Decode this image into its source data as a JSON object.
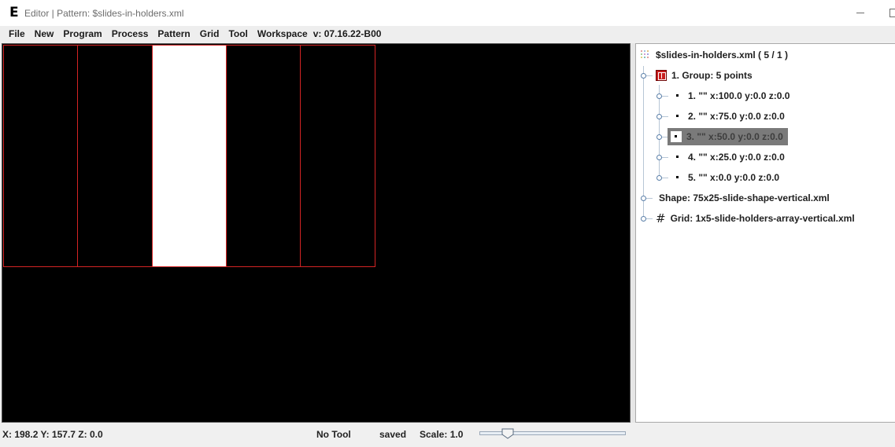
{
  "window": {
    "app_letter": "E",
    "title": "Editor | Pattern: $slides-in-holders.xml"
  },
  "menu": {
    "items": [
      "File",
      "New",
      "Program",
      "Process",
      "Pattern",
      "Grid",
      "Tool",
      "Workspace"
    ],
    "version": "v: 07.16.22-B00"
  },
  "canvas": {
    "slot_fill": [
      "black",
      "black",
      "white",
      "black",
      "black"
    ],
    "colors": {
      "background": "#000000",
      "slot_border": "#d42424",
      "highlight": "#ffffff"
    }
  },
  "tree": {
    "root": "$slides-in-holders.xml ( 5 / 1 )",
    "group": "1. Group: 5 points",
    "points": [
      "1. \"\" x:100.0 y:0.0 z:0.0",
      "2. \"\" x:75.0 y:0.0 z:0.0",
      "3. \"\" x:50.0 y:0.0 z:0.0",
      "4. \"\" x:25.0 y:0.0 z:0.0",
      "5. \"\" x:0.0 y:0.0 z:0.0"
    ],
    "selected_point": "3. \"\" x:50.0 y:0.0 z:0.0",
    "shape": "Shape: 75x25-slide-shape-vertical.xml",
    "grid": "Grid: 1x5-slide-holders-array-vertical.xml"
  },
  "status": {
    "coords": "X: 198.2  Y: 157.7  Z: 0.0",
    "tool": "No Tool",
    "saved": "saved",
    "scale": "Scale: 1.0"
  }
}
